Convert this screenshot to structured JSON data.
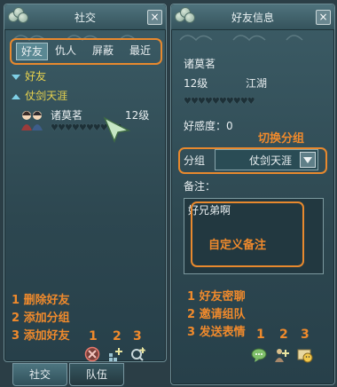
{
  "left_panel": {
    "title": "社交",
    "tabs": [
      {
        "label": "好友"
      },
      {
        "label": "仇人"
      },
      {
        "label": "屏蔽"
      },
      {
        "label": "最近"
      }
    ],
    "groups": [
      {
        "label": "好友"
      },
      {
        "label": "仗剑天涯"
      }
    ],
    "friend": {
      "name": "诸莫茗",
      "level": "12级"
    },
    "annotations": [
      "1  删除好友",
      "2  添加分组",
      "3  添加好友"
    ],
    "icon_numbers": [
      "1",
      "2",
      "3"
    ],
    "bottom_tabs": [
      {
        "label": "社交"
      },
      {
        "label": "队伍"
      }
    ]
  },
  "right_panel": {
    "title": "好友信息",
    "name": "诸莫茗",
    "level": "12级",
    "faction": "江湖",
    "favor_label": "好感度：0",
    "switch_group_note": "切换分组",
    "group_label": "分组",
    "group_value": "仗剑天涯",
    "remark_label": "备注：",
    "remark_text": "好兄弟啊",
    "remark_note": "自定义备注",
    "annotations": [
      "1  好友密聊",
      "2  邀请组队",
      "3  发送表情"
    ],
    "icon_numbers": [
      "1",
      "2",
      "3"
    ]
  },
  "colors": {
    "highlight": "#e8892e",
    "accent_text": "#e7d24e",
    "panel": "#2d4750"
  }
}
